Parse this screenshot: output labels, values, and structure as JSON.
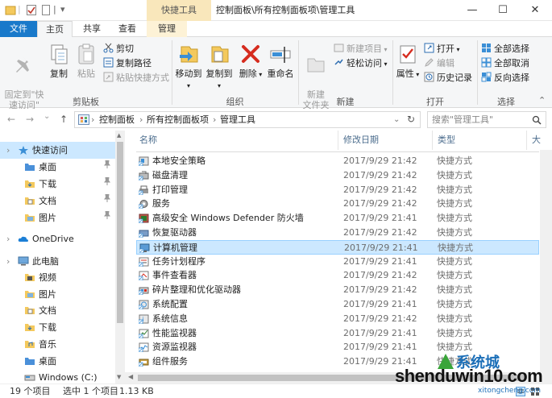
{
  "titlebar": {
    "context_tab_header": "快捷工具",
    "title": "控制面板\\所有控制面板项\\管理工具",
    "qa_sep": "|",
    "qa_dropdown": "▾",
    "qa_label": "|",
    "minimize": "—",
    "maximize": "☐",
    "close": "✕"
  },
  "ribbon_tabs": [
    "文件",
    "主页",
    "共享",
    "查看",
    "管理"
  ],
  "ribbon": {
    "clipboard": {
      "pin": "固定到\"快\n速访问\"",
      "copy": "复制",
      "paste": "粘贴",
      "cut": "剪切",
      "copy_path": "复制路径",
      "paste_shortcut": "粘贴快捷方式",
      "label": "剪贴板"
    },
    "organize": {
      "move_to": "移动到",
      "copy_to": "复制到",
      "delete": "删除",
      "rename": "重命名",
      "label": "组织"
    },
    "new": {
      "new_folder": "新建\n文件夹",
      "new_item": "新建项目",
      "easy_access": "轻松访问",
      "label": "新建"
    },
    "open": {
      "properties": "属性",
      "open": "打开",
      "edit": "编辑",
      "history": "历史记录",
      "label": "打开"
    },
    "select": {
      "select_all": "全部选择",
      "select_none": "全部取消",
      "invert": "反向选择",
      "label": "选择"
    }
  },
  "address": {
    "back": "←",
    "forward": "→",
    "dropdown": "⌄",
    "up": "↑",
    "crumbs": [
      "控制面板",
      "所有控制面板项",
      "管理工具"
    ],
    "crumb_sep": "›",
    "refresh": "↻",
    "search_placeholder": "搜索\"管理工具\"",
    "search_icon": "search-icon"
  },
  "navpane": {
    "items": [
      {
        "label": "快速访问",
        "icon": "star-icon",
        "pinned": false
      },
      {
        "label": "桌面",
        "icon": "folder-icon",
        "pinned": true
      },
      {
        "label": "下载",
        "icon": "download-icon",
        "pinned": true
      },
      {
        "label": "文档",
        "icon": "document-icon",
        "pinned": true
      },
      {
        "label": "图片",
        "icon": "picture-icon",
        "pinned": true
      },
      {
        "label": "OneDrive",
        "icon": "cloud-icon",
        "pinned": false
      },
      {
        "label": "此电脑",
        "icon": "computer-icon",
        "pinned": false
      },
      {
        "label": "视频",
        "icon": "video-icon",
        "pinned": false
      },
      {
        "label": "图片",
        "icon": "picture-icon",
        "pinned": false
      },
      {
        "label": "文档",
        "icon": "document-icon",
        "pinned": false
      },
      {
        "label": "下载",
        "icon": "download-icon",
        "pinned": false
      },
      {
        "label": "音乐",
        "icon": "music-icon",
        "pinned": false
      },
      {
        "label": "桌面",
        "icon": "folder-icon",
        "pinned": false
      },
      {
        "label": "Windows (C:)",
        "icon": "drive-icon",
        "pinned": false
      }
    ],
    "pin_glyph": "📌",
    "expand_glyph": "›"
  },
  "filelist": {
    "columns": [
      "名称",
      "修改日期",
      "类型",
      "大"
    ],
    "sort_glyph": "^",
    "files": [
      {
        "name": "本地安全策略",
        "date": "2017/9/29 21:42",
        "type": "快捷方式",
        "selected": false
      },
      {
        "name": "磁盘清理",
        "date": "2017/9/29 21:42",
        "type": "快捷方式",
        "selected": false
      },
      {
        "name": "打印管理",
        "date": "2017/9/29 21:42",
        "type": "快捷方式",
        "selected": false
      },
      {
        "name": "服务",
        "date": "2017/9/29 21:42",
        "type": "快捷方式",
        "selected": false
      },
      {
        "name": "高级安全 Windows Defender 防火墙",
        "date": "2017/9/29 21:41",
        "type": "快捷方式",
        "selected": false
      },
      {
        "name": "恢复驱动器",
        "date": "2017/9/29 21:42",
        "type": "快捷方式",
        "selected": false
      },
      {
        "name": "计算机管理",
        "date": "2017/9/29 21:41",
        "type": "快捷方式",
        "selected": true
      },
      {
        "name": "任务计划程序",
        "date": "2017/9/29 21:41",
        "type": "快捷方式",
        "selected": false
      },
      {
        "name": "事件查看器",
        "date": "2017/9/29 21:42",
        "type": "快捷方式",
        "selected": false
      },
      {
        "name": "碎片整理和优化驱动器",
        "date": "2017/9/29 21:42",
        "type": "快捷方式",
        "selected": false
      },
      {
        "name": "系统配置",
        "date": "2017/9/29 21:41",
        "type": "快捷方式",
        "selected": false
      },
      {
        "name": "系统信息",
        "date": "2017/9/29 21:42",
        "type": "快捷方式",
        "selected": false
      },
      {
        "name": "性能监视器",
        "date": "2017/9/29 21:41",
        "type": "快捷方式",
        "selected": false
      },
      {
        "name": "资源监视器",
        "date": "2017/9/29 21:41",
        "type": "快捷方式",
        "selected": false
      },
      {
        "name": "组件服务",
        "date": "2017/9/29 21:41",
        "type": "快捷方式",
        "selected": false
      }
    ]
  },
  "statusbar": {
    "item_count": "19 个项目",
    "selected": "选中 1 个项目",
    "size": "1.13 KB"
  },
  "watermark": {
    "text": "shenduwin10.com",
    "brand": "系统城",
    "url": "xitongcheng.com"
  },
  "colors": {
    "file_tab": "#1979ca",
    "selection": "#cce8ff",
    "context_tab": "#f9e7bb"
  }
}
